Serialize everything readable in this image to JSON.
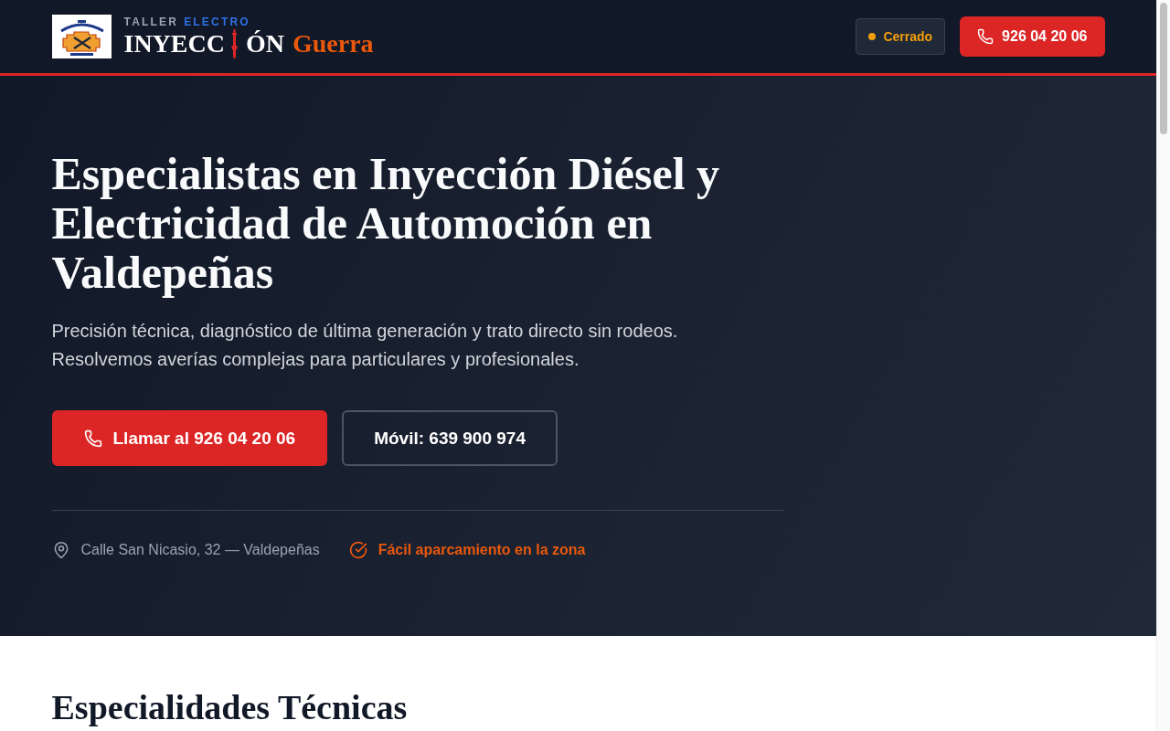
{
  "header": {
    "brand": {
      "tagline": [
        {
          "text": "TALLER",
          "kind": "muted"
        },
        {
          "text": "ELECTRO",
          "kind": "accent"
        }
      ],
      "name_before_icon": "INYECC",
      "name_after_icon": "ÓN",
      "name_accent": "Guerra"
    },
    "status": {
      "label": "Cerrado",
      "open": false
    },
    "phone_button": {
      "label": "926 04 20 06"
    }
  },
  "hero": {
    "title": "Especialistas en Inyección Diésel y Electricidad de Automoción en Valdepeñas",
    "subtitle": "Precisión técnica, diagnóstico de última generación y trato directo sin rodeos. Resolvemos averías complejas para particulares y profesionales.",
    "buttons": [
      {
        "label": "Llamar al 926 04 20 06",
        "kind": "primary"
      },
      {
        "label": "Móvil: 639 900 974",
        "kind": "outline"
      }
    ],
    "details": [
      {
        "text": "Calle San Nicasio, 32 — Valdepeñas",
        "kind": "address"
      },
      {
        "text": "Fácil aparcamiento en la zona",
        "kind": "parking"
      }
    ]
  },
  "specialties": {
    "title": "Especialidades Técnicas"
  }
}
